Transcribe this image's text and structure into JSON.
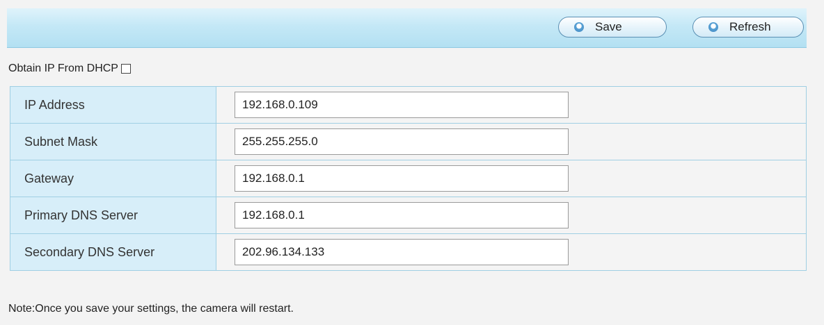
{
  "toolbar": {
    "save_label": "Save",
    "refresh_label": "Refresh"
  },
  "dhcp": {
    "label": "Obtain IP From DHCP",
    "checked": false
  },
  "fields": [
    {
      "label": "IP Address",
      "value": "192.168.0.109"
    },
    {
      "label": "Subnet Mask",
      "value": "255.255.255.0"
    },
    {
      "label": "Gateway",
      "value": "192.168.0.1"
    },
    {
      "label": "Primary DNS Server",
      "value": "192.168.0.1"
    },
    {
      "label": "Secondary DNS Server",
      "value": "202.96.134.133"
    }
  ],
  "note": "Note:Once you save your settings, the camera will restart.",
  "colors": {
    "toolbar_bg": "#c4e8f6",
    "label_cell_bg": "#d7eef9",
    "border": "#9fcfe3"
  },
  "icons": {
    "button_icon": "circle-arrow-icon"
  }
}
